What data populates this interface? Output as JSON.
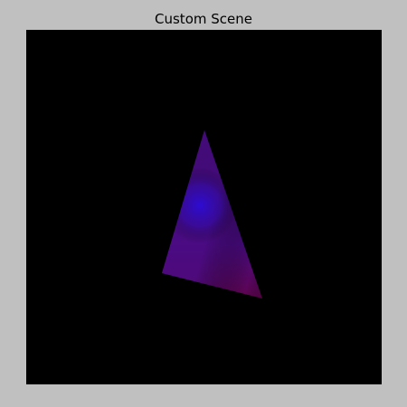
{
  "window": {
    "title": "Custom Scene"
  },
  "scene": {
    "background_color": "#000000",
    "triangle": {
      "vertex_colors": {
        "top": "#2a0a55",
        "left": "#4a0b83",
        "right": "#6a0033"
      },
      "highlight_color": "#2d0bd8"
    }
  }
}
